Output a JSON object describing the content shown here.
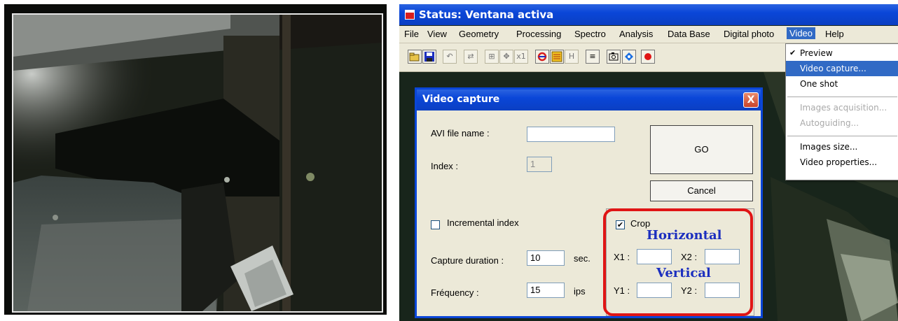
{
  "window": {
    "title": "Status: Ventana activa"
  },
  "menubar": {
    "items": [
      "File",
      "View",
      "Geometry",
      "Processing",
      "Spectro",
      "Analysis",
      "Data Base",
      "Digital photo",
      "Video",
      "Help"
    ],
    "active": "Video"
  },
  "toolbar": {
    "buttons": [
      "open-icon",
      "save-icon",
      "undo-icon",
      "adjust-icon",
      "zoom-fit-icon",
      "zoom-move-icon",
      "zoom-x1-icon",
      "refresh-icon",
      "list-icon",
      "histogram-icon",
      "palette-icon",
      "camera-icon",
      "blue-target-icon",
      "red-dot-icon"
    ],
    "x1_label": "x1",
    "h_label": "H"
  },
  "video_menu": {
    "items": [
      {
        "label": "Preview",
        "checked": true,
        "state": "normal"
      },
      {
        "label": "Video capture...",
        "state": "selected"
      },
      {
        "label": "One shot",
        "state": "normal"
      },
      {
        "label": "Images acquisition...",
        "state": "disabled"
      },
      {
        "label": "Autoguiding...",
        "state": "disabled"
      },
      {
        "label": "Images size...",
        "state": "normal"
      },
      {
        "label": "Video properties...",
        "state": "normal"
      }
    ]
  },
  "dialog": {
    "title": "Video capture",
    "close_label": "X",
    "avi_label": "AVI file name :",
    "avi_value": "",
    "index_label": "Index :",
    "index_value": "1",
    "go_label": "GO",
    "cancel_label": "Cancel",
    "incremental_label": "Incremental index",
    "incremental_checked": false,
    "duration_label": "Capture duration :",
    "duration_value": "10",
    "duration_unit": "sec.",
    "frequency_label": "Fréquency :",
    "frequency_value": "15",
    "frequency_unit": "ips",
    "crop_label": "Crop",
    "crop_checked": true,
    "horizontal_label": "Horizontal",
    "vertical_label": "Vertical",
    "x1_label": "X1 :",
    "x2_label": "X2 :",
    "y1_label": "Y1 :",
    "y2_label": "Y2 :",
    "x1_value": "",
    "x2_value": "",
    "y1_value": "",
    "y2_value": ""
  },
  "colors": {
    "title_blue": "#0a46d8",
    "highlight": "#316ac5",
    "crop_outline": "#e01515",
    "annotation_blue": "#1c2fbf"
  }
}
